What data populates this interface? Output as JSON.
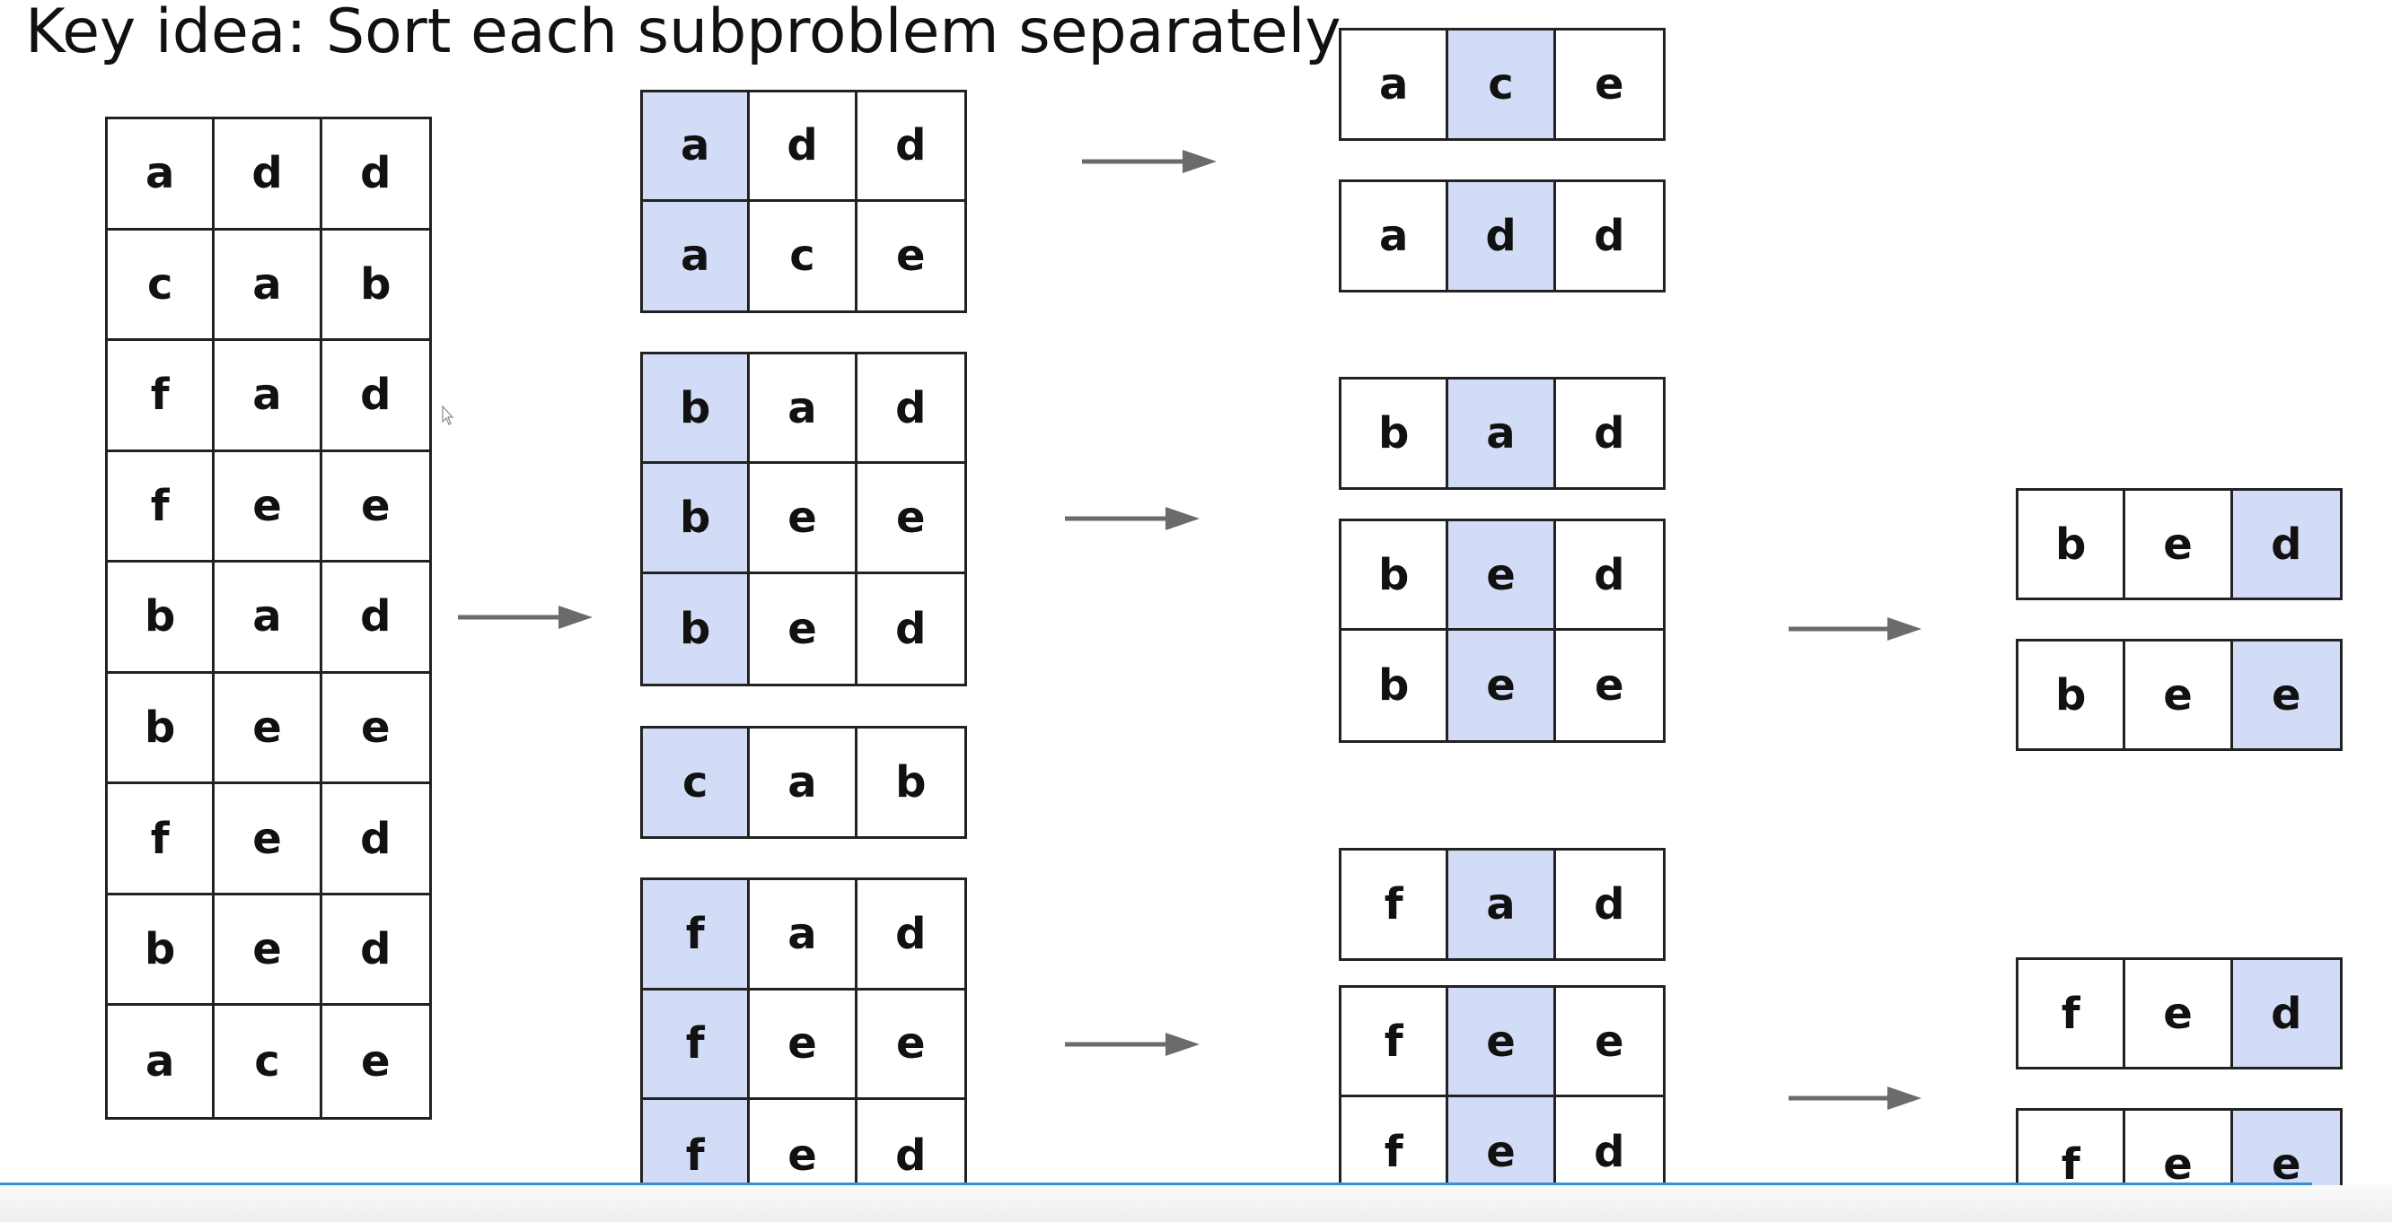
{
  "title": "Key idea: Sort each subproblem separately.",
  "highlight_color": "#d2dcf6",
  "tables": [
    {
      "id": "input",
      "hl": -1,
      "rows": [
        [
          "a",
          "d",
          "d"
        ],
        [
          "c",
          "a",
          "b"
        ],
        [
          "f",
          "a",
          "d"
        ],
        [
          "f",
          "e",
          "e"
        ],
        [
          "b",
          "a",
          "d"
        ],
        [
          "b",
          "e",
          "e"
        ],
        [
          "f",
          "e",
          "d"
        ],
        [
          "b",
          "e",
          "d"
        ],
        [
          "a",
          "c",
          "e"
        ]
      ]
    },
    {
      "id": "step1-group-a",
      "hl": 0,
      "rows": [
        [
          "a",
          "d",
          "d"
        ],
        [
          "a",
          "c",
          "e"
        ]
      ]
    },
    {
      "id": "step1-group-b",
      "hl": 0,
      "rows": [
        [
          "b",
          "a",
          "d"
        ],
        [
          "b",
          "e",
          "e"
        ],
        [
          "b",
          "e",
          "d"
        ]
      ]
    },
    {
      "id": "step1-group-c",
      "hl": 0,
      "rows": [
        [
          "c",
          "a",
          "b"
        ]
      ]
    },
    {
      "id": "step1-group-f",
      "hl": 0,
      "rows": [
        [
          "f",
          "a",
          "d"
        ],
        [
          "f",
          "e",
          "e"
        ],
        [
          "f",
          "e",
          "d"
        ]
      ]
    },
    {
      "id": "step2-ac",
      "hl": 1,
      "rows": [
        [
          "a",
          "c",
          "e"
        ]
      ]
    },
    {
      "id": "step2-ad",
      "hl": 1,
      "rows": [
        [
          "a",
          "d",
          "d"
        ]
      ]
    },
    {
      "id": "step2-ba",
      "hl": 1,
      "rows": [
        [
          "b",
          "a",
          "d"
        ]
      ]
    },
    {
      "id": "step2-be",
      "hl": 1,
      "rows": [
        [
          "b",
          "e",
          "d"
        ],
        [
          "b",
          "e",
          "e"
        ]
      ]
    },
    {
      "id": "step2-fa",
      "hl": 1,
      "rows": [
        [
          "f",
          "a",
          "d"
        ]
      ]
    },
    {
      "id": "step2-fe",
      "hl": 1,
      "rows": [
        [
          "f",
          "e",
          "e"
        ],
        [
          "f",
          "e",
          "d"
        ]
      ]
    },
    {
      "id": "step3-bed",
      "hl": 2,
      "rows": [
        [
          "b",
          "e",
          "d"
        ]
      ]
    },
    {
      "id": "step3-bee",
      "hl": 2,
      "rows": [
        [
          "b",
          "e",
          "e"
        ]
      ]
    },
    {
      "id": "step3-fed",
      "hl": 2,
      "rows": [
        [
          "f",
          "e",
          "d"
        ]
      ]
    },
    {
      "id": "step3-fee",
      "hl": 2,
      "rows": [
        [
          "f",
          "e",
          "e"
        ]
      ]
    }
  ],
  "arrows": [
    "arrow-input-to-groups",
    "arrow-group-a",
    "arrow-group-b",
    "arrow-group-f",
    "arrow-be",
    "arrow-fe"
  ]
}
